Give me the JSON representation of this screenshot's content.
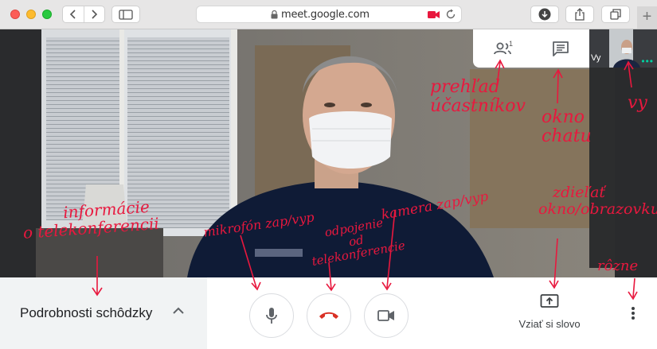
{
  "browser": {
    "url": "meet.google.com",
    "new_tab_symbol": "+"
  },
  "meet": {
    "self_label": "Vy",
    "people_count": "1",
    "meeting_details_label": "Podrobnosti schôdzky",
    "present_label": "Vziať si slovo",
    "icons": [
      "people-icon",
      "chat-icon",
      "mic-icon",
      "hangup-icon",
      "camera-icon",
      "present-icon",
      "more-vert-icon",
      "chevron-up-icon"
    ]
  },
  "annotations": {
    "participants": [
      "prehľad",
      "účastníkov"
    ],
    "chat": [
      "okno",
      "chatu"
    ],
    "you": "vy",
    "info": [
      "informácie",
      "o telekonferencii"
    ],
    "mic": "mikrofón zap/vyp",
    "disconnect": [
      "odpojenie",
      "od",
      "telekonferencie"
    ],
    "camera": "kamera zap/vyp",
    "share": [
      "zdieľať",
      "okno/obrazovku"
    ],
    "misc": "rôzne"
  },
  "colors": {
    "annotation": "#e8183e",
    "hangup": "#d93025",
    "accent": "#00d0a0"
  }
}
